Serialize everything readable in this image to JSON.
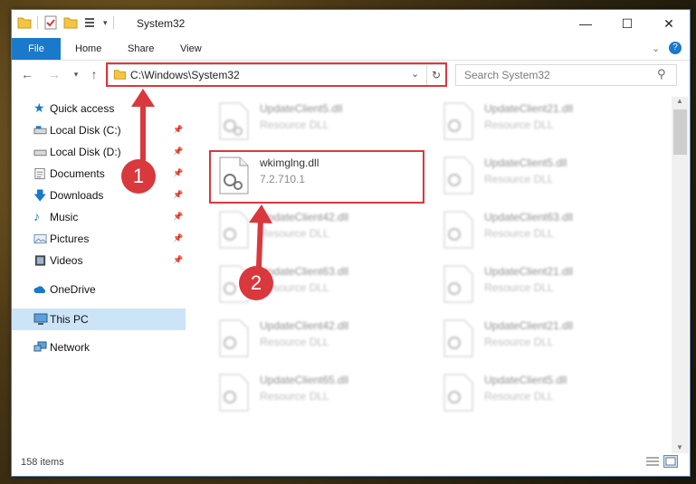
{
  "window": {
    "title": "System32"
  },
  "ribbon": {
    "tabs": [
      "File",
      "Home",
      "Share",
      "View"
    ]
  },
  "address": {
    "path": "C:\\Windows\\System32"
  },
  "search": {
    "placeholder": "Search System32"
  },
  "nav": {
    "items": [
      {
        "label": "Quick access",
        "icon": "star-icon"
      },
      {
        "label": "Local Disk (C:)",
        "icon": "drive-icon",
        "pinned": true
      },
      {
        "label": "Local Disk (D:)",
        "icon": "drive-icon",
        "pinned": true
      },
      {
        "label": "Documents",
        "icon": "documents-icon",
        "pinned": true
      },
      {
        "label": "Downloads",
        "icon": "downloads-icon",
        "pinned": true
      },
      {
        "label": "Music",
        "icon": "music-icon",
        "pinned": true
      },
      {
        "label": "Pictures",
        "icon": "pictures-icon",
        "pinned": true
      },
      {
        "label": "Videos",
        "icon": "videos-icon",
        "pinned": true
      },
      {
        "label": "OneDrive",
        "icon": "onedrive-icon"
      },
      {
        "label": "This PC",
        "icon": "this-pc-icon",
        "selected": true
      },
      {
        "label": "Network",
        "icon": "network-icon"
      }
    ]
  },
  "files": {
    "left": [
      {
        "name": "UpdateClient5.dll",
        "desc": "Resource DLL"
      },
      {
        "name": "wkimglng.dll",
        "desc": "7.2.710.1",
        "highlighted": true
      },
      {
        "name": "UpdateClient42.dll",
        "desc": "Resource DLL"
      },
      {
        "name": "UpdateClient63.dll",
        "desc": "Resource DLL"
      },
      {
        "name": "UpdateClient42.dll",
        "desc": "Resource DLL"
      },
      {
        "name": "UpdateClient65.dll",
        "desc": "Resource DLL"
      }
    ],
    "right": [
      {
        "name": "UpdateClient21.dll",
        "desc": "Resource DLL"
      },
      {
        "name": "UpdateClient5.dll",
        "desc": "Resource DLL"
      },
      {
        "name": "UpdateClient63.dll",
        "desc": "Resource DLL"
      },
      {
        "name": "UpdateClient21.dll",
        "desc": "Resource DLL"
      },
      {
        "name": "UpdateClient21.dll",
        "desc": "Resource DLL"
      },
      {
        "name": "UpdateClient5.dll",
        "desc": "Resource DLL"
      }
    ]
  },
  "status": {
    "item_count": "158 items"
  },
  "annotations": {
    "step1": "1",
    "step2": "2",
    "accent": "#d9383d"
  }
}
